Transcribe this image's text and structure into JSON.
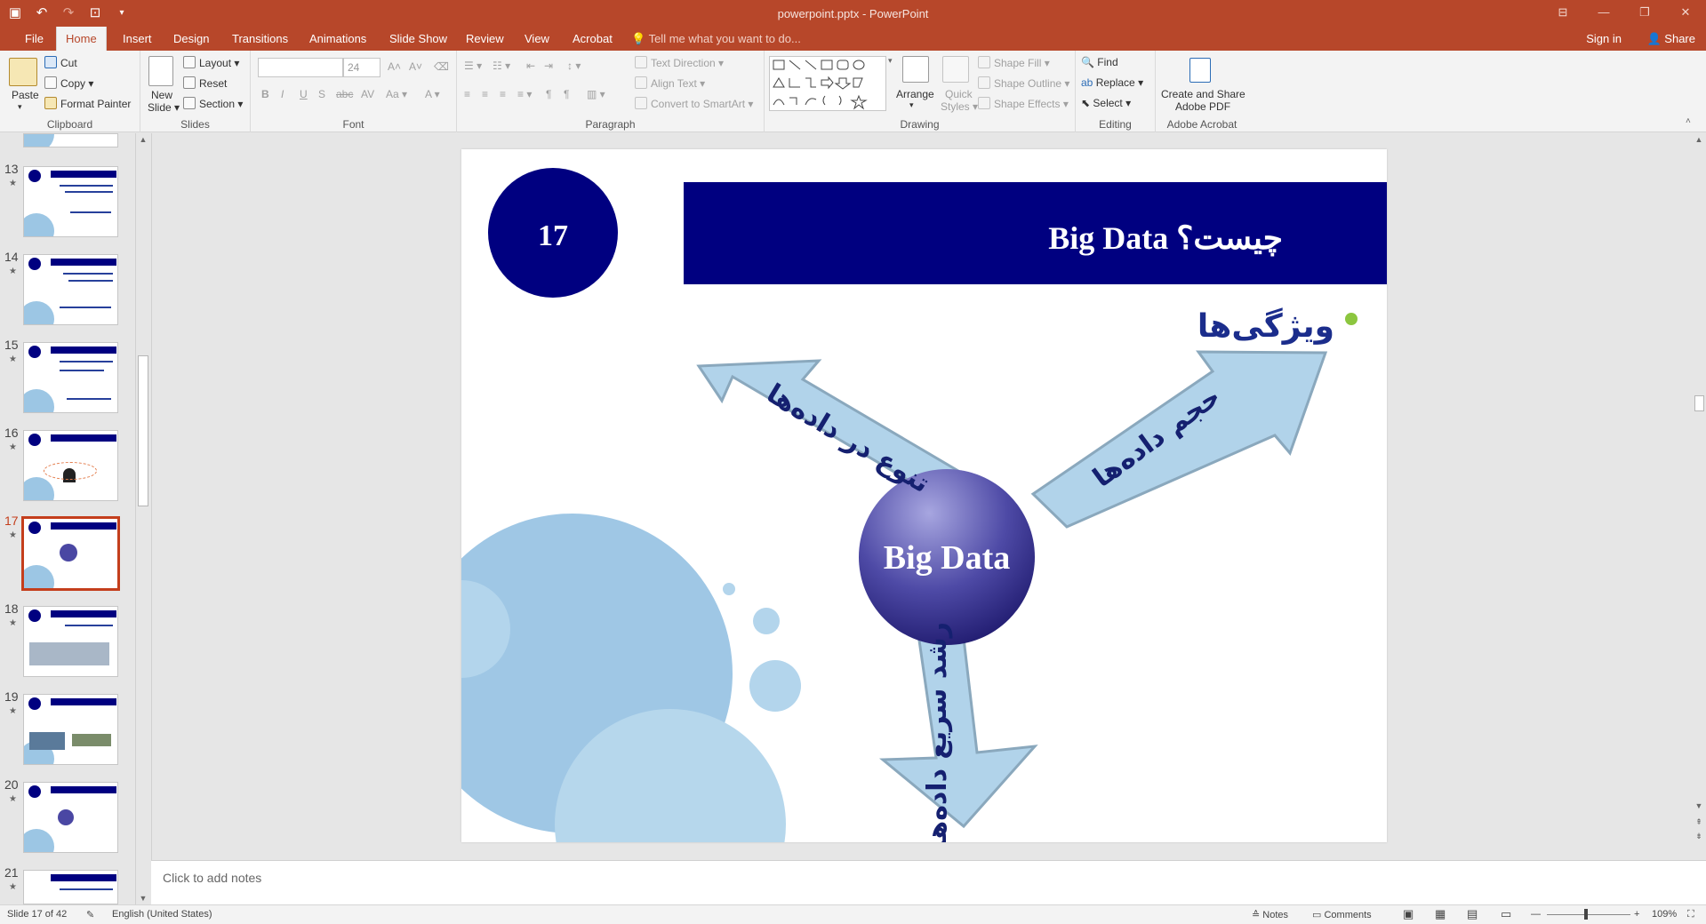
{
  "window": {
    "title": "powerpoint.pptx - PowerPoint"
  },
  "tabs": [
    "File",
    "Home",
    "Insert",
    "Design",
    "Transitions",
    "Animations",
    "Slide Show",
    "Review",
    "View",
    "Acrobat"
  ],
  "tell_me": "Tell me what you want to do...",
  "sign_in": "Sign in",
  "share": "Share",
  "ribbon": {
    "clipboard": {
      "label": "Clipboard",
      "paste": "Paste",
      "cut": "Cut",
      "copy": "Copy",
      "format_painter": "Format Painter"
    },
    "slides": {
      "label": "Slides",
      "new_slide_1": "New",
      "new_slide_2": "Slide",
      "layout": "Layout",
      "reset": "Reset",
      "section": "Section"
    },
    "font": {
      "label": "Font",
      "font_name": "",
      "font_size": "24"
    },
    "paragraph": {
      "label": "Paragraph",
      "text_direction": "Text Direction",
      "align_text": "Align Text",
      "convert_smartart": "Convert to SmartArt"
    },
    "drawing": {
      "label": "Drawing",
      "arrange": "Arrange",
      "quick_styles_1": "Quick",
      "quick_styles_2": "Styles",
      "shape_fill": "Shape Fill",
      "shape_outline": "Shape Outline",
      "shape_effects": "Shape Effects"
    },
    "editing": {
      "label": "Editing",
      "find": "Find",
      "replace": "Replace",
      "select": "Select"
    },
    "acrobat": {
      "label": "Adobe Acrobat",
      "create_1": "Create and Share",
      "create_2": "Adobe PDF"
    }
  },
  "thumbnails": [
    {
      "num": "13",
      "selected": false
    },
    {
      "num": "14",
      "selected": false
    },
    {
      "num": "15",
      "selected": false
    },
    {
      "num": "16",
      "selected": false
    },
    {
      "num": "17",
      "selected": true
    },
    {
      "num": "18",
      "selected": false
    },
    {
      "num": "19",
      "selected": false
    },
    {
      "num": "20",
      "selected": false
    },
    {
      "num": "21",
      "selected": false
    }
  ],
  "slide": {
    "number_badge": "17",
    "title": "Big Data چیست؟",
    "bullet": "ویژگی‌ها",
    "center_label": "Big Data",
    "arrow_left": "تنوع در داده‌ها",
    "arrow_right": "حجم داده‌ها",
    "arrow_down": "رشد سریع داده‌ها"
  },
  "notes_placeholder": "Click to add notes",
  "status": {
    "slide_info": "Slide 17 of 42",
    "language": "English (United States)",
    "notes": "Notes",
    "comments": "Comments",
    "zoom": "109%"
  },
  "colors": {
    "brand": "#b7472a",
    "navy": "#000080",
    "light_blue": "#b1d3ea",
    "bullet_green": "#8cc63f"
  }
}
